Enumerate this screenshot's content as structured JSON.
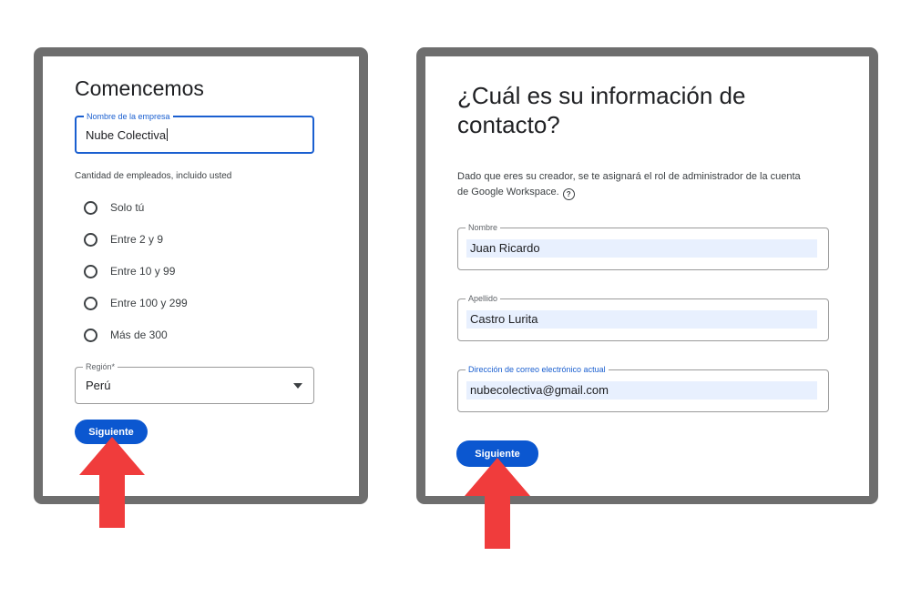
{
  "left_panel": {
    "title": "Comencemos",
    "company_field": {
      "label": "Nombre de la empresa",
      "value": "Nube Colectiva"
    },
    "employees_label": "Cantidad de empleados, incluido usted",
    "employee_options": [
      "Solo tú",
      "Entre 2 y 9",
      "Entre 10 y 99",
      "Entre 100 y 299",
      "Más de 300"
    ],
    "region_field": {
      "label": "Región*",
      "value": "Perú"
    },
    "next_button": "Siguiente"
  },
  "right_panel": {
    "title_line1": "¿Cuál es su información de",
    "title_line2": "contacto?",
    "description_line1": "Dado que eres su creador, se te asignará el rol de administrador de la cuenta",
    "description_line2": "de Google Workspace.",
    "first_name_field": {
      "label": "Nombre",
      "value": "Juan Ricardo"
    },
    "last_name_field": {
      "label": "Apellido",
      "value": "Castro Lurita"
    },
    "email_field": {
      "label": "Dirección de correo electrónico actual",
      "value": "nubecolectiva@gmail.com"
    },
    "next_button": "Siguiente"
  },
  "icons": {
    "help": "help-circle-icon",
    "dropdown": "caret-down-icon",
    "arrow": "red-up-arrow-icon"
  },
  "colors": {
    "accent": "#0b57d0",
    "focus_border": "#1a5fd0",
    "autofill_bg": "#e8f0fe",
    "frame": "#6e6e6e",
    "arrow": "#f03c3c"
  }
}
